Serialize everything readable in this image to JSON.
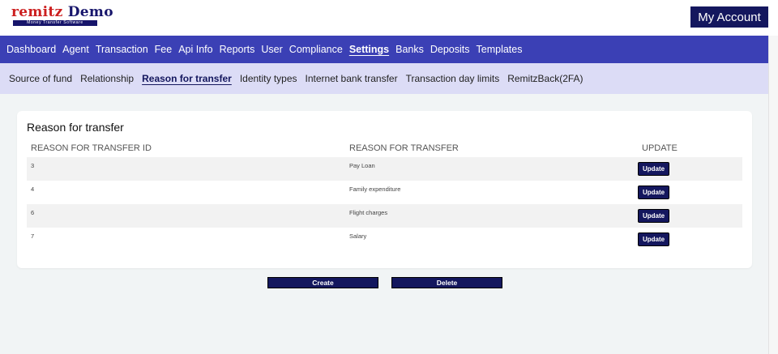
{
  "brand": {
    "logo_main": "remitz",
    "logo_accent": "Demo",
    "tagline": "Money Transfer Software"
  },
  "header": {
    "my_account_label": "My Account"
  },
  "main_nav": {
    "items": [
      "Dashboard",
      "Agent",
      "Transaction",
      "Fee",
      "Api Info",
      "Reports",
      "User",
      "Compliance",
      "Settings",
      "Banks",
      "Deposits",
      "Templates"
    ],
    "active": "Settings"
  },
  "sub_nav": {
    "items": [
      "Source of fund",
      "Relationship",
      "Reason for transfer",
      "Identity types",
      "Internet bank transfer",
      "Transaction day limits",
      "RemitzBack(2FA)"
    ],
    "active": "Reason for transfer"
  },
  "card": {
    "title": "Reason for transfer",
    "columns": [
      "REASON FOR TRANSFER ID",
      "REASON FOR TRANSFER",
      "UPDATE"
    ],
    "rows": [
      {
        "id": "3",
        "reason": "Pay Loan",
        "action": "Update"
      },
      {
        "id": "4",
        "reason": "Family expenditure",
        "action": "Update"
      },
      {
        "id": "6",
        "reason": "Flight charges",
        "action": "Update"
      },
      {
        "id": "7",
        "reason": "Salary",
        "action": "Update"
      }
    ]
  },
  "actions": {
    "create_label": "Create",
    "delete_label": "Delete"
  },
  "colors": {
    "brand_red": "#cc1f1f",
    "brand_navy": "#14175e",
    "main_nav_bg": "#3b40b5",
    "sub_nav_bg": "#dcdcf6",
    "page_bg": "#f1f4f5"
  }
}
